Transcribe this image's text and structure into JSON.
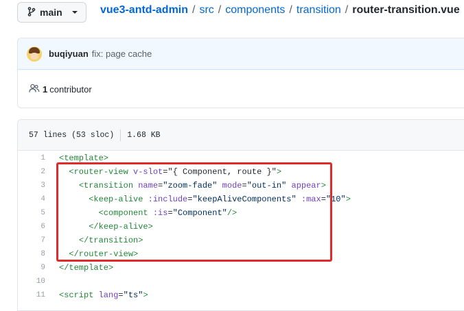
{
  "branch": {
    "label": "main",
    "icon": "branch-icon"
  },
  "breadcrumb": {
    "repo": "vue3-antd-admin",
    "parts": [
      "src",
      "components",
      "transition"
    ],
    "file": "router-transition.vue"
  },
  "commit": {
    "author": "buqiyuan",
    "message": "fix: page cache"
  },
  "contributors": {
    "count": "1",
    "label": "contributor"
  },
  "file_info": {
    "lines": "57 lines (53 sloc)",
    "size": "1.68 KB"
  },
  "code_lines": [
    {
      "n": "1",
      "t": [
        [
          "tag",
          "<template>"
        ]
      ]
    },
    {
      "n": "2",
      "t": [
        [
          "pun",
          "  "
        ],
        [
          "tag",
          "<router-view "
        ],
        [
          "attr",
          "v-slot"
        ],
        [
          "pun",
          "=\"{ Component, route }\""
        ],
        [
          "tag",
          ">"
        ]
      ]
    },
    {
      "n": "3",
      "t": [
        [
          "pun",
          "    "
        ],
        [
          "tag",
          "<transition "
        ],
        [
          "attr",
          "name"
        ],
        [
          "pun",
          "="
        ],
        [
          "str",
          "\"zoom-fade\""
        ],
        [
          "pun",
          " "
        ],
        [
          "attr",
          "mode"
        ],
        [
          "pun",
          "="
        ],
        [
          "str",
          "\"out-in\""
        ],
        [
          "pun",
          " "
        ],
        [
          "attr",
          "appear"
        ],
        [
          "tag",
          ">"
        ]
      ]
    },
    {
      "n": "4",
      "t": [
        [
          "pun",
          "      "
        ],
        [
          "tag",
          "<keep-alive "
        ],
        [
          "attr",
          ":include"
        ],
        [
          "pun",
          "="
        ],
        [
          "str",
          "\"keepAliveComponents\""
        ],
        [
          "pun",
          " "
        ],
        [
          "attr",
          ":max"
        ],
        [
          "pun",
          "="
        ],
        [
          "str",
          "\"10\""
        ],
        [
          "tag",
          ">"
        ]
      ]
    },
    {
      "n": "5",
      "t": [
        [
          "pun",
          "        "
        ],
        [
          "tag",
          "<component "
        ],
        [
          "attr",
          ":is"
        ],
        [
          "pun",
          "="
        ],
        [
          "str",
          "\"Component\""
        ],
        [
          "tag",
          "/>"
        ]
      ]
    },
    {
      "n": "6",
      "t": [
        [
          "pun",
          "      "
        ],
        [
          "tag",
          "</keep-alive>"
        ]
      ]
    },
    {
      "n": "7",
      "t": [
        [
          "pun",
          "    "
        ],
        [
          "tag",
          "</transition>"
        ]
      ]
    },
    {
      "n": "8",
      "t": [
        [
          "pun",
          "  "
        ],
        [
          "tag",
          "</router-view>"
        ]
      ]
    },
    {
      "n": "9",
      "t": [
        [
          "tag",
          "</template>"
        ]
      ]
    },
    {
      "n": "10",
      "t": []
    },
    {
      "n": "11",
      "t": [
        [
          "tag",
          "<script "
        ],
        [
          "attr",
          "lang"
        ],
        [
          "pun",
          "="
        ],
        [
          "str",
          "\"ts\""
        ],
        [
          "tag",
          ">"
        ]
      ]
    }
  ],
  "colors": {
    "highlight_box": "#e02b2b",
    "link": "#0366d6"
  }
}
